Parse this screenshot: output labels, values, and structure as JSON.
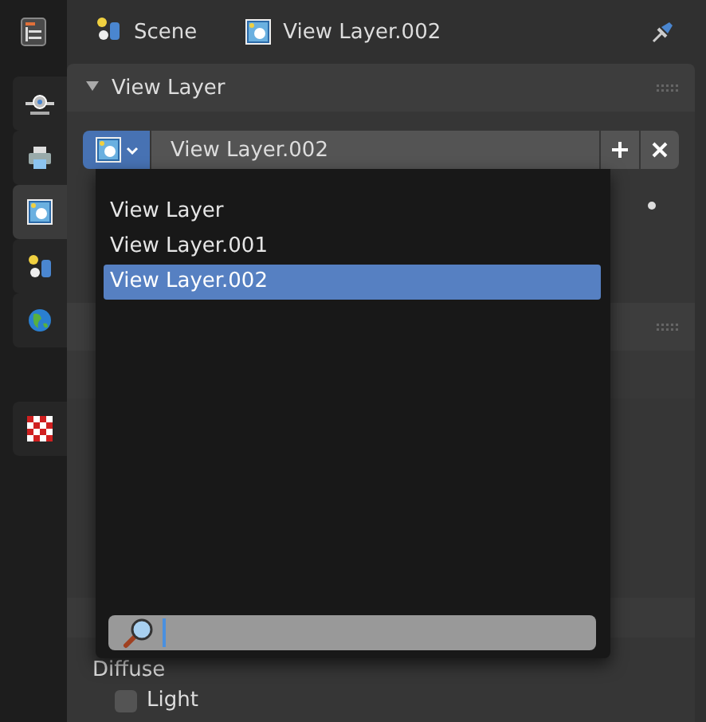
{
  "sidebar": {
    "tabs": [
      {
        "kind": "tool",
        "selected": false
      },
      {
        "kind": "render",
        "selected": false
      },
      {
        "kind": "view_layer",
        "selected": true
      },
      {
        "kind": "scene",
        "selected": false
      },
      {
        "kind": "world",
        "selected": false
      },
      {
        "kind": "texture",
        "selected": false
      }
    ]
  },
  "header": {
    "scene": "Scene",
    "view_layer": "View Layer.002"
  },
  "panel": {
    "title": "View Layer",
    "expanded": true
  },
  "layer_selector": {
    "value": "View Layer.002"
  },
  "dropdown": {
    "items": [
      {
        "label": "View Layer",
        "selected": false
      },
      {
        "label": "View Layer.001",
        "selected": false
      },
      {
        "label": "View Layer.002",
        "selected": true
      }
    ]
  },
  "diffuse": {
    "label": "Diffuse",
    "options": [
      {
        "label": "Light",
        "checked": false
      }
    ]
  }
}
